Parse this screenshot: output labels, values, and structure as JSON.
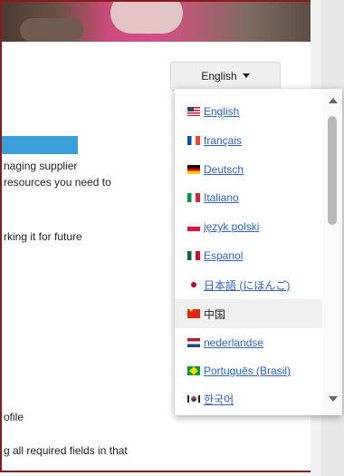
{
  "language_button": {
    "label": "English"
  },
  "background_text": [
    "naging supplier",
    " resources you need to",
    "rking it for future",
    "ofile",
    "g all required fields in that"
  ],
  "language_menu": {
    "items": [
      {
        "label": "English",
        "flag": "us-flag-icon"
      },
      {
        "label": "français",
        "flag": "france-flag-icon"
      },
      {
        "label": "Deutsch",
        "flag": "germany-flag-icon"
      },
      {
        "label": "Italiano",
        "flag": "italy-flag-icon"
      },
      {
        "label": "język polski",
        "flag": "poland-flag-icon"
      },
      {
        "label": "Espanol",
        "flag": "mexico-flag-icon"
      },
      {
        "label": "日本語 (にほんご)",
        "flag": "japan-flag-icon"
      },
      {
        "label": "中国",
        "flag": "china-flag-icon"
      },
      {
        "label": "nederlandse",
        "flag": "netherlands-flag-icon"
      },
      {
        "label": "Português (Brasil)",
        "flag": "brazil-flag-icon"
      },
      {
        "label": "한국어",
        "flag": "korea-flag-icon"
      }
    ],
    "highlighted_index": 7
  },
  "colors": {
    "link": "#2b63c6",
    "accent_bar": "#3ba0d9",
    "frame_border": "#8b1a1a"
  }
}
